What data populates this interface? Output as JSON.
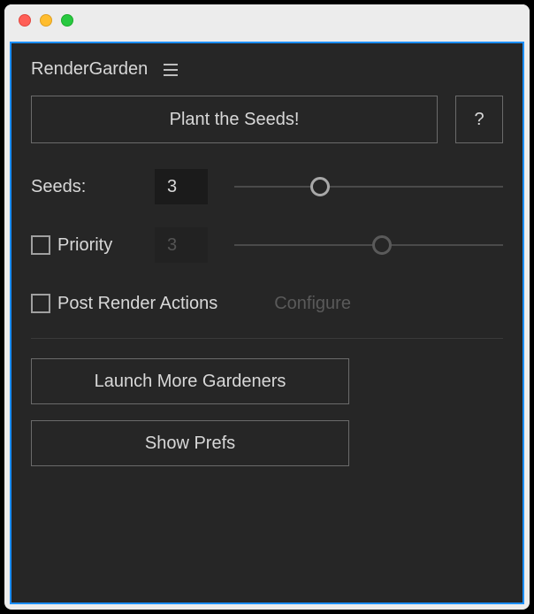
{
  "window": {
    "panel_title": "RenderGarden"
  },
  "buttons": {
    "plant": "Plant the Seeds!",
    "help": "?",
    "configure": "Configure",
    "launch": "Launch More Gardeners",
    "prefs": "Show Prefs"
  },
  "seeds": {
    "label": "Seeds:",
    "value": "3",
    "slider_pct": 32
  },
  "priority": {
    "label": "Priority",
    "checked": false,
    "value": "3",
    "slider_pct": 55
  },
  "post_render": {
    "label": "Post Render Actions",
    "checked": false
  }
}
